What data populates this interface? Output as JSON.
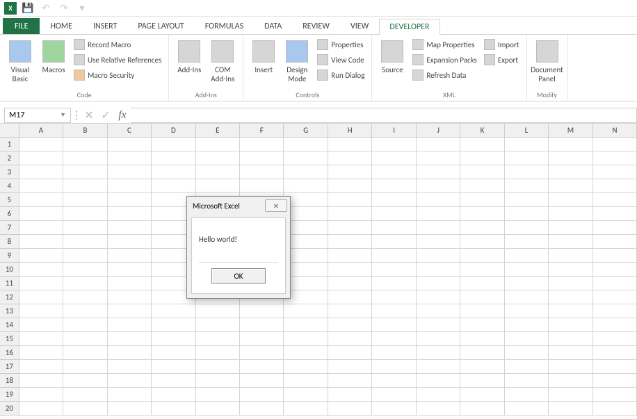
{
  "qat": {
    "app_label": "X"
  },
  "tabs": {
    "file": "FILE",
    "items": [
      "HOME",
      "INSERT",
      "PAGE LAYOUT",
      "FORMULAS",
      "DATA",
      "REVIEW",
      "VIEW",
      "DEVELOPER"
    ],
    "active_index": 7
  },
  "ribbon": {
    "groups": {
      "code": {
        "label": "Code",
        "visual_basic": "Visual Basic",
        "macros": "Macros",
        "record_macro": "Record Macro",
        "use_relative": "Use Relative References",
        "macro_security": "Macro Security"
      },
      "addins": {
        "label": "Add-Ins",
        "addins": "Add-Ins",
        "com_addins": "COM Add-Ins"
      },
      "controls": {
        "label": "Controls",
        "insert": "Insert",
        "design_mode": "Design Mode",
        "properties": "Properties",
        "view_code": "View Code",
        "run_dialog": "Run Dialog"
      },
      "xml": {
        "label": "XML",
        "source": "Source",
        "map_properties": "Map Properties",
        "expansion_packs": "Expansion Packs",
        "refresh_data": "Refresh Data",
        "import": "Import",
        "export": "Export"
      },
      "modify": {
        "label": "Modify",
        "document_panel": "Document Panel"
      }
    }
  },
  "formula_bar": {
    "name_box": "M17",
    "fx": "fx"
  },
  "grid": {
    "columns": [
      "A",
      "B",
      "C",
      "D",
      "E",
      "F",
      "G",
      "H",
      "I",
      "J",
      "K",
      "L",
      "M",
      "N"
    ],
    "row_count": 20
  },
  "msgbox": {
    "title": "Microsoft Excel",
    "message": "Hello world!",
    "ok": "OK"
  }
}
